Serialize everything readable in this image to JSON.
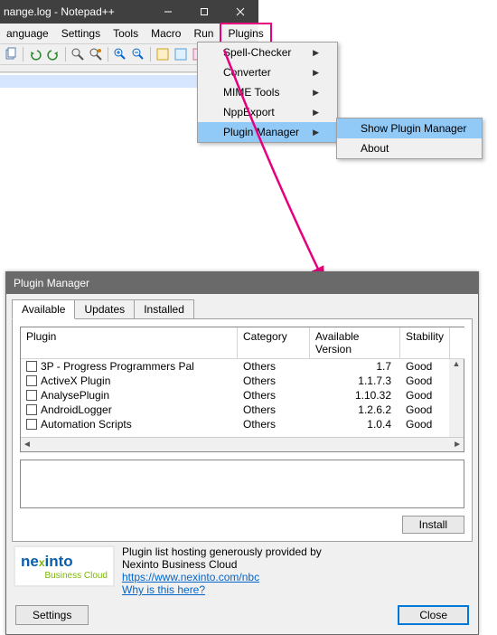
{
  "npp": {
    "title": "nange.log - Notepad++",
    "menubar": [
      "anguage",
      "Settings",
      "Tools",
      "Macro",
      "Run",
      "Plugins"
    ]
  },
  "dropmenu": {
    "items": [
      {
        "label": "Spell-Checker",
        "sub": true
      },
      {
        "label": "Converter",
        "sub": true
      },
      {
        "label": "MIME Tools",
        "sub": true
      },
      {
        "label": "NppExport",
        "sub": true
      },
      {
        "label": "Plugin Manager",
        "sub": true,
        "hl": true
      }
    ]
  },
  "submenu": {
    "items": [
      {
        "label": "Show Plugin Manager",
        "hl": true
      },
      {
        "label": "About"
      }
    ]
  },
  "pm": {
    "title": "Plugin Manager",
    "tabs": [
      "Available",
      "Updates",
      "Installed"
    ],
    "columns": {
      "plugin": "Plugin",
      "category": "Category",
      "version": "Available Version",
      "stability": "Stability"
    },
    "rows": [
      {
        "name": "3P - Progress Programmers Pal",
        "cat": "Others",
        "ver": "1.7",
        "stab": "Good"
      },
      {
        "name": "ActiveX Plugin",
        "cat": "Others",
        "ver": "1.1.7.3",
        "stab": "Good"
      },
      {
        "name": "AnalysePlugin",
        "cat": "Others",
        "ver": "1.10.32",
        "stab": "Good"
      },
      {
        "name": "AndroidLogger",
        "cat": "Others",
        "ver": "1.2.6.2",
        "stab": "Good"
      },
      {
        "name": "Automation Scripts",
        "cat": "Others",
        "ver": "1.0.4",
        "stab": "Good"
      }
    ],
    "install": "Install",
    "info1": "Plugin list hosting generously provided by",
    "info2": "Nexinto Business Cloud",
    "info_url": "https://www.nexinto.com/nbc",
    "info_why": "Why is this here?",
    "settings": "Settings",
    "close": "Close",
    "logo": {
      "brand": "nexinto",
      "sub": "Business Cloud"
    }
  }
}
